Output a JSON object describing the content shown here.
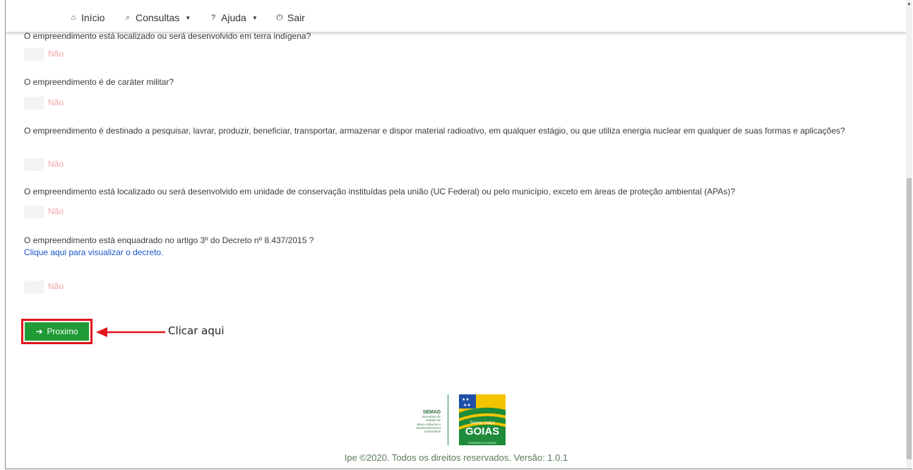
{
  "navbar": {
    "items": [
      {
        "label": "Início",
        "icon": "home-icon",
        "glyph": "⌂"
      },
      {
        "label": "Consultas",
        "icon": "search-icon",
        "glyph": "⌕",
        "dropdown": true
      },
      {
        "label": "Ajuda",
        "icon": "question-icon",
        "glyph": "?",
        "dropdown": true
      },
      {
        "label": "Sair",
        "icon": "power-icon",
        "glyph": "⏻"
      }
    ]
  },
  "questions": [
    {
      "text": "O empreendimento está localizado ou será desenvolvido em terra indígena?",
      "answer": "Não"
    },
    {
      "text": "O empreendimento é de caráter militar?",
      "answer": "Não"
    },
    {
      "text": "O empreendimento é destinado a pesquisar, lavrar, produzir, beneficiar, transportar, armazenar e dispor material radioativo, em qualquer estágio, ou que utiliza energia nuclear em qualquer de suas formas e aplicações?",
      "answer": "Não"
    },
    {
      "text": "O empreendimento está localizado ou será desenvolvido em unidade de conservação instituídas pela união (UC Federal) ou pelo município, exceto em áreas de proteção ambiental (APAs)?",
      "answer": "Não"
    },
    {
      "text": "O empreendimento está enquadrado no artigo 3º do Decreto nº 8.437/2015 ?",
      "link": "Clique aqui para visualizar o decreto.",
      "answer": "Não"
    }
  ],
  "next_button": {
    "label": "Proximo",
    "icon": "arrow-right-icon"
  },
  "annotation": {
    "text": "Clicar aqui"
  },
  "footer": {
    "semad_title": "SEMAD",
    "semad_sub": [
      "Secretaria de",
      "Estado de",
      "Meio Ambiente e",
      "Desenvolvimento",
      "Sustentável"
    ],
    "goias_tagline": "Somos todos",
    "goias_name": "GOIAS",
    "goias_sub": "GOVERNO DO ESTADO",
    "copyright": "Ipe ©2020. Todos os direitos reservados. Versão: 1.0.1"
  },
  "colors": {
    "accent_green": "#1f9b35",
    "highlight_red": "#e3141b",
    "answer_text": "#f5a3a3",
    "link": "#1a56c9"
  }
}
